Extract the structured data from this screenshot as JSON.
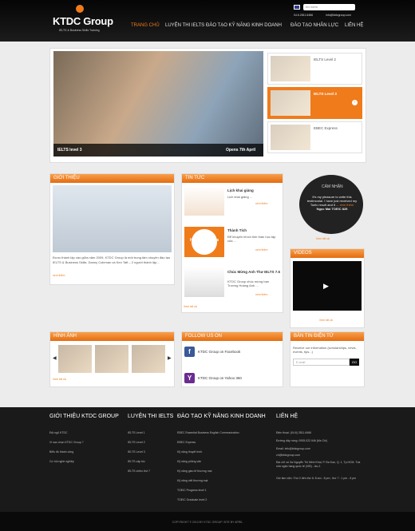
{
  "header": {
    "logo_text": "KTDC Group",
    "logo_tagline": "IELTS & Business Skills Training",
    "search_placeholder": "tìm kiếm",
    "phone": "04.6.2811.6466",
    "email": "info@ktdcgroup.com",
    "nav": [
      "TRANG CHỦ",
      "LUYỆN THI IELTS",
      "ĐÀO TẠO KỸ NĂNG KINH DOANH",
      "ĐÀO TẠO NHÂN LỰC",
      "LIÊN HỆ"
    ]
  },
  "hero": {
    "title": "IELTS level 3",
    "date": "Opens 7th April",
    "thumbs": [
      "IELTS Level 2",
      "IELTS Level 3",
      "EBEC Express"
    ]
  },
  "intro": {
    "title": "GIỚI THIỆU",
    "text": "Được thành lập vào giữa năm 2009, KTDC Group là một trung tâm chuyên đào tạo IELTS & Business Skills. Danny Coleman và Ken Taft – 2 người thành lập...",
    "more": "xem thêm"
  },
  "news": {
    "title": "TIN TỨC",
    "items": [
      {
        "title": "Lịch khai giảng",
        "desc": "Lịch khai giảng ...",
        "more": "xem thêm"
      },
      {
        "title": "Thành Tích",
        "desc": "Để khuyến khích tinh thần học tập của ...",
        "more": "xem thêm"
      },
      {
        "title": "Chúc Mừng Anh Thư IELTS 7.5",
        "desc": "KTDC Group chúc mừng bạn Trương Hoàng Anh ...",
        "more": "xem thêm"
      }
    ],
    "badge_text": "High Achievers",
    "all": "Xem tất cả"
  },
  "testimonial": {
    "title": "CẢM NHẬN",
    "text": "It's my pleasure to write this testimonial. I have just received my Toeic result and it ...",
    "author": "Ngọc Mai TOEIC 825",
    "more": "Xem tất cả",
    "read_more": "xem thêm"
  },
  "videos": {
    "title": "VIDEOS",
    "all": "Xem tất cả"
  },
  "gallery": {
    "title": "HÌNH ẢNH",
    "more": "Xem tất cả"
  },
  "follow": {
    "title": "FOLLOW US ON",
    "facebook": "KTDC Group on Facebook",
    "yahoo": "KTDC Group on Yahoo 360"
  },
  "newsletter": {
    "title": "BẢN TIN ĐIỆN TỬ",
    "desc": "Receive our information (scholarships, news, events, tips...)",
    "placeholder": "E-mail",
    "button": "GO"
  },
  "footer": {
    "col1_title": "GIỚI THIỆU KTDC GROUP",
    "col1_links": [
      "Đội ngũ KTDC",
      "Vì sao chọn KTDC Group ?",
      "Biểu đồ thành công",
      "Cơ hội nghề nghiệp"
    ],
    "col2_title": "LUYỆN THI IELTS",
    "col2_links": [
      "IELTS Level 1",
      "IELTS Level 2",
      "IELTS Level 3",
      "IELTS cấp tốc",
      "IELTS chiều thứ 7"
    ],
    "col3_title": "ĐÀO TẠO KỸ NĂNG KINH DOANH",
    "col3_links": [
      "EBEC Essential Business English Communication",
      "EBEC Express",
      "Kỹ năng thuyết trình",
      "Kỹ năng phỏng vấn",
      "Kỹ năng giao tế thương mại",
      "Kỹ năng viết thương mại",
      "TOEIC Progress level 1",
      "TOEIC Graduate level 2"
    ],
    "col4_title": "LIÊN HỆ",
    "contact": [
      "Điện thoại: (04.6) 2811.6466",
      "Đường dây nóng: 0935.022.946 (Ms Chi)",
      "Email: info@ktdcgroup.com",
      "ch@ktdcgroup.com",
      "Địa chỉ: số 3a Nguyễn Thị Minh Khai, P. Đa Kao, Q. 1, Tp.HCM. Tòa nhà ngân hàng quốc tế (VIB) - lầu 1",
      "Giờ làm việc: Thứ 2 đến thứ 6: 8 am - 8 pm ; thứ 7 : 1 pm - 6 pm"
    ],
    "copyright": "COPYRIGHT © 2013 BY KTDC GROUP. SITE BY APRIL"
  }
}
